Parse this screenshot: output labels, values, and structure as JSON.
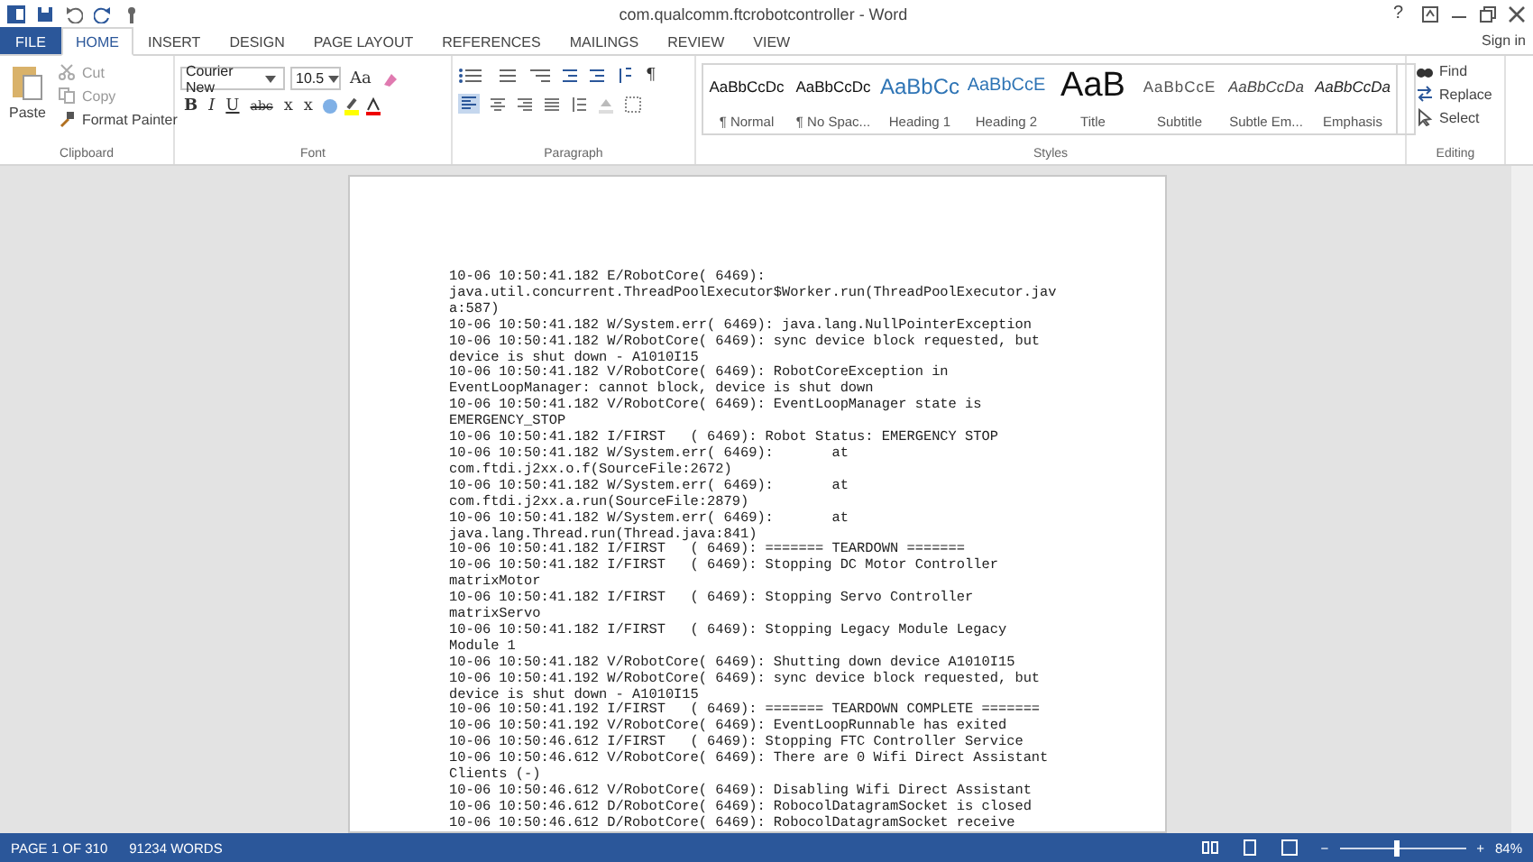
{
  "window": {
    "title": "com.qualcomm.ftcrobotcontroller - Word",
    "help": "?",
    "sign_in": "Sign in"
  },
  "tabs": [
    {
      "label": "FILE",
      "kind": "file",
      "selected": false
    },
    {
      "label": "HOME",
      "kind": "tab",
      "selected": true
    },
    {
      "label": "INSERT",
      "kind": "tab",
      "selected": false
    },
    {
      "label": "DESIGN",
      "kind": "tab",
      "selected": false
    },
    {
      "label": "PAGE LAYOUT",
      "kind": "tab",
      "selected": false
    },
    {
      "label": "REFERENCES",
      "kind": "tab",
      "selected": false
    },
    {
      "label": "MAILINGS",
      "kind": "tab",
      "selected": false
    },
    {
      "label": "REVIEW",
      "kind": "tab",
      "selected": false
    },
    {
      "label": "VIEW",
      "kind": "tab",
      "selected": false
    }
  ],
  "clipboard": {
    "paste": "Paste",
    "cut": "Cut",
    "copy": "Copy",
    "format_painter": "Format Painter",
    "label": "Clipboard",
    "cut_disabled": true,
    "copy_disabled": true
  },
  "font": {
    "family": "Courier New",
    "size": "10.5",
    "case": "Aa",
    "bold": "B",
    "italic": "I",
    "underline": "U",
    "strike": "abc",
    "sub": "x",
    "sup": "x",
    "label": "Font"
  },
  "paragraph": {
    "mark": "¶",
    "label": "Paragraph"
  },
  "styles": {
    "label": "Styles",
    "items": [
      {
        "preview": "AaBbCcDc",
        "name": "¶ Normal",
        "kind": "normal"
      },
      {
        "preview": "AaBbCcDc",
        "name": "¶ No Spac...",
        "kind": "normal"
      },
      {
        "preview": "AaBbCc",
        "name": "Heading 1",
        "kind": "heading1"
      },
      {
        "preview": "AaBbCcE",
        "name": "Heading 2",
        "kind": "heading2"
      },
      {
        "preview": "AaB",
        "name": "Title",
        "kind": "title"
      },
      {
        "preview": "AaBbCcE",
        "name": "Subtitle",
        "kind": "subtitle"
      },
      {
        "preview": "AaBbCcDa",
        "name": "Subtle Em...",
        "kind": "subtle"
      },
      {
        "preview": "AaBbCcDa",
        "name": "Emphasis",
        "kind": "emphasis"
      }
    ]
  },
  "editing": {
    "find": "Find",
    "replace": "Replace",
    "select": "Select",
    "label": "Editing"
  },
  "document": {
    "lines": [
      "10-06 10:50:41.182 E/RobotCore( 6469):",
      "java.util.concurrent.ThreadPoolExecutor$Worker.run(ThreadPoolExecutor.jav",
      "a:587)",
      "10-06 10:50:41.182 W/System.err( 6469): java.lang.NullPointerException",
      "10-06 10:50:41.182 W/RobotCore( 6469): sync device block requested, but",
      "device is shut down - A1010I15",
      "10-06 10:50:41.182 V/RobotCore( 6469): RobotCoreException in",
      "EventLoopManager: cannot block, device is shut down",
      "10-06 10:50:41.182 V/RobotCore( 6469): EventLoopManager state is",
      "EMERGENCY_STOP",
      "10-06 10:50:41.182 I/FIRST   ( 6469): Robot Status: EMERGENCY STOP",
      "10-06 10:50:41.182 W/System.err( 6469):       at",
      "com.ftdi.j2xx.o.f(SourceFile:2672)",
      "10-06 10:50:41.182 W/System.err( 6469):       at",
      "com.ftdi.j2xx.a.run(SourceFile:2879)",
      "10-06 10:50:41.182 W/System.err( 6469):       at",
      "java.lang.Thread.run(Thread.java:841)",
      "10-06 10:50:41.182 I/FIRST   ( 6469): ======= TEARDOWN =======",
      "10-06 10:50:41.182 I/FIRST   ( 6469): Stopping DC Motor Controller",
      "matrixMotor",
      "10-06 10:50:41.182 I/FIRST   ( 6469): Stopping Servo Controller",
      "matrixServo",
      "10-06 10:50:41.182 I/FIRST   ( 6469): Stopping Legacy Module Legacy",
      "Module 1",
      "10-06 10:50:41.182 V/RobotCore( 6469): Shutting down device A1010I15",
      "10-06 10:50:41.192 W/RobotCore( 6469): sync device block requested, but",
      "device is shut down - A1010I15",
      "10-06 10:50:41.192 I/FIRST   ( 6469): ======= TEARDOWN COMPLETE =======",
      "10-06 10:50:41.192 V/RobotCore( 6469): EventLoopRunnable has exited",
      "10-06 10:50:46.612 I/FIRST   ( 6469): Stopping FTC Controller Service",
      "10-06 10:50:46.612 V/RobotCore( 6469): There are 0 Wifi Direct Assistant",
      "Clients (-)",
      "10-06 10:50:46.612 V/RobotCore( 6469): Disabling Wifi Direct Assistant",
      "10-06 10:50:46.612 D/RobotCore( 6469): RobocolDatagramSocket is closed",
      "10-06 10:50:46.612 D/RobotCore( 6469): RobocolDatagramSocket receive"
    ]
  },
  "status_bar": {
    "page": "PAGE 1 OF 310",
    "words": "91234 WORDS",
    "zoom": "84%",
    "level": 0.45,
    "minus": "−",
    "plus": "+"
  }
}
